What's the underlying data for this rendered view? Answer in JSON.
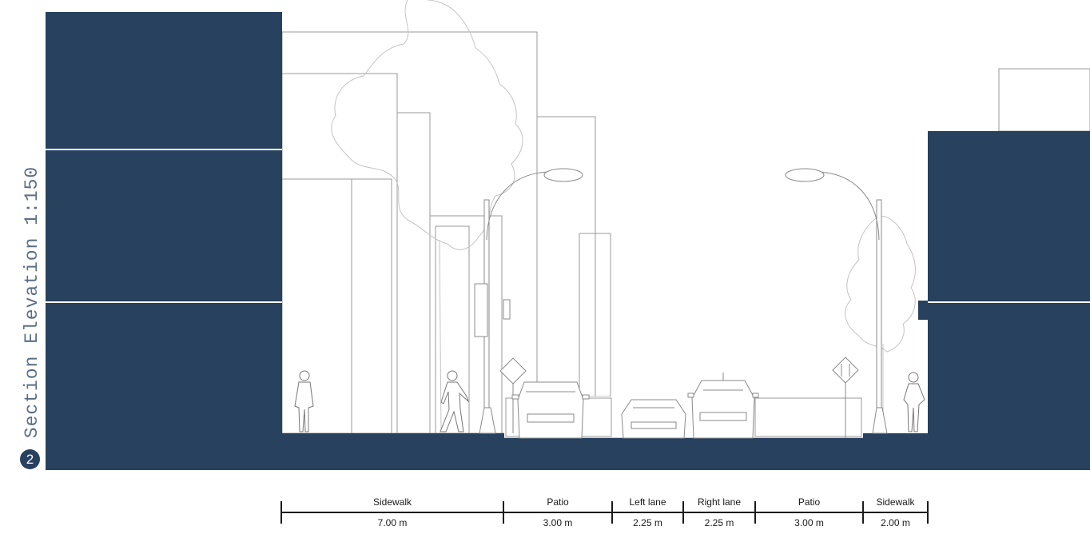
{
  "title": "Section Elevation 1:150",
  "section_number": "2",
  "colors": {
    "building_fill": "#27415f",
    "line_gray": "#9a9a9a",
    "tree_gray": "#c4c4c4",
    "dimension_line": "#1a1a1a"
  },
  "dimensions": [
    {
      "name": "Sidewalk",
      "width": "7.00 m"
    },
    {
      "name": "Patio",
      "width": "3.00 m"
    },
    {
      "name": "Left lane",
      "width": "2.25 m"
    },
    {
      "name": "Right lane",
      "width": "2.25 m"
    },
    {
      "name": "Patio",
      "width": "3.00 m"
    },
    {
      "name": "Sidewalk",
      "width": "2.00 m"
    }
  ]
}
